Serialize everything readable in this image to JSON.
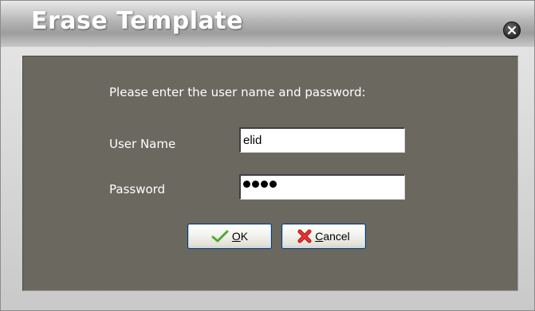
{
  "dialog": {
    "title": "Erase Template",
    "prompt": "Please enter the user name and password:",
    "user_name_label": "User Name",
    "user_name_value": "elid",
    "password_label": "Password",
    "password_length": 4,
    "ok_label": {
      "mnemonic": "O",
      "rest": "K"
    },
    "cancel_label": {
      "mnemonic": "C",
      "rest": "ancel"
    }
  },
  "icons": {
    "close": "close-icon",
    "ok": "checkmark-icon",
    "cancel": "red-x-icon"
  },
  "colors": {
    "content_bg": "#6b685f",
    "title_text": "#ffffff",
    "button_border": "#003c74"
  }
}
